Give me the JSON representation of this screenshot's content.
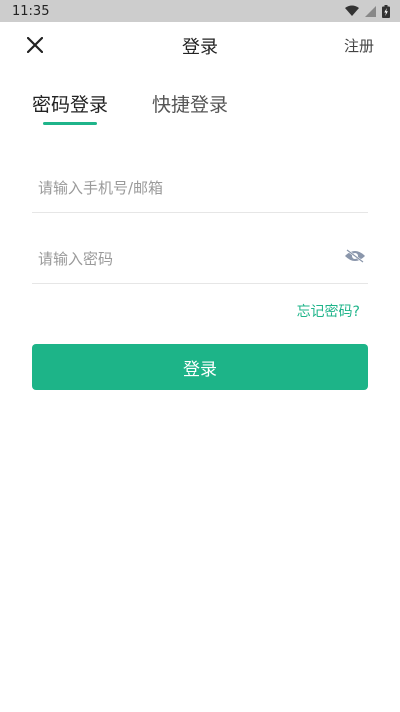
{
  "status_bar": {
    "time": "11:35"
  },
  "nav": {
    "title": "登录",
    "register_label": "注册",
    "close_icon": "close-icon"
  },
  "tabs": [
    {
      "label": "密码登录",
      "active": true
    },
    {
      "label": "快捷登录",
      "active": false
    }
  ],
  "form": {
    "account_placeholder": "请输入手机号/邮箱",
    "account_value": "",
    "password_placeholder": "请输入密码",
    "password_value": "",
    "forgot_label": "忘记密码?",
    "login_label": "登录"
  },
  "colors": {
    "accent": "#1db488",
    "status_bar_bg": "#cdcdcd"
  }
}
